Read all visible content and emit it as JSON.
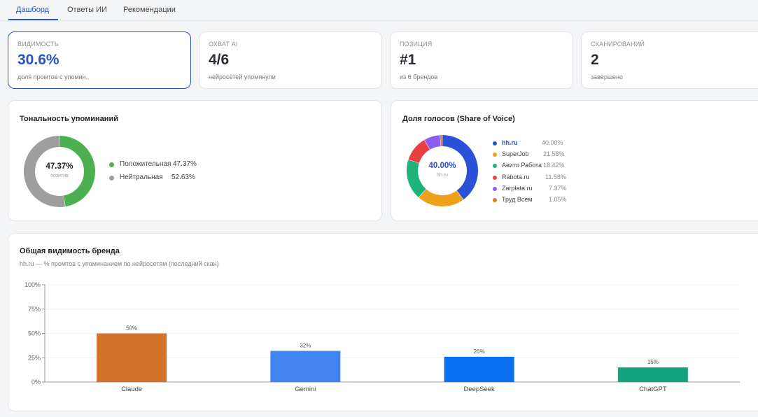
{
  "tabs": [
    {
      "label": "Дашборд",
      "active": true
    },
    {
      "label": "Ответы ИИ",
      "active": false
    },
    {
      "label": "Рекомендации",
      "active": false
    }
  ],
  "kpis": [
    {
      "label": "ВИДИМОСТЬ",
      "value": "30.6%",
      "sub": "доля промтов с упомин."
    },
    {
      "label": "ОХВАТ AI",
      "value": "4/6",
      "sub": "нейросетей упомянули"
    },
    {
      "label": "ПОЗИЦИЯ",
      "value": "#1",
      "sub": "из 6 брендов"
    },
    {
      "label": "СКАНИРОВАНИЙ",
      "value": "2",
      "sub": "завершено"
    }
  ],
  "sentiment": {
    "title": "Тональность упоминаний",
    "center_value": "47.37%",
    "center_sub": "позитив",
    "items": [
      {
        "label": "Положительная",
        "value": "47.37%",
        "share": 47.37,
        "color": "#4caf50"
      },
      {
        "label": "Нейтральная",
        "value": "52.63%",
        "share": 52.63,
        "color": "#9e9e9e"
      }
    ]
  },
  "share_of_voice": {
    "title": "Доля голосов (Share of Voice)",
    "center_value": "40.00%",
    "center_sub": "hh.ru",
    "items": [
      {
        "label": "hh.ru",
        "value": "40.00%",
        "share": 40.0,
        "color": "#2b52d6"
      },
      {
        "label": "SuperJob",
        "value": "21.58%",
        "share": 21.58,
        "color": "#f0a11c"
      },
      {
        "label": "Авито Работа",
        "value": "18.42%",
        "share": 18.42,
        "color": "#1fb37c"
      },
      {
        "label": "Rabota.ru",
        "value": "11.58%",
        "share": 11.58,
        "color": "#e8403f"
      },
      {
        "label": "Zarplata.ru",
        "value": "7.37%",
        "share": 7.37,
        "color": "#8a5cf0"
      },
      {
        "label": "Труд Всем",
        "value": "1.05%",
        "share": 1.05,
        "color": "#e8742a"
      }
    ]
  },
  "visibility": {
    "title": "Общая видимость бренда",
    "subtitle": "hh.ru — % промтов с упоминанием по нейросетям (последний скан)"
  },
  "chart_data": {
    "type": "bar",
    "categories": [
      "Claude",
      "Gemini",
      "DeepSeek",
      "ChatGPT"
    ],
    "values": [
      50,
      32,
      26,
      15
    ],
    "value_labels": [
      "50%",
      "32%",
      "26%",
      "15%"
    ],
    "colors": [
      "#d4712b",
      "#4285f0",
      "#0a6ff0",
      "#14a37f"
    ],
    "ylim": [
      0,
      100
    ],
    "yticks": [
      "0%",
      "25%",
      "50%",
      "75%",
      "100%"
    ],
    "grid": true
  }
}
